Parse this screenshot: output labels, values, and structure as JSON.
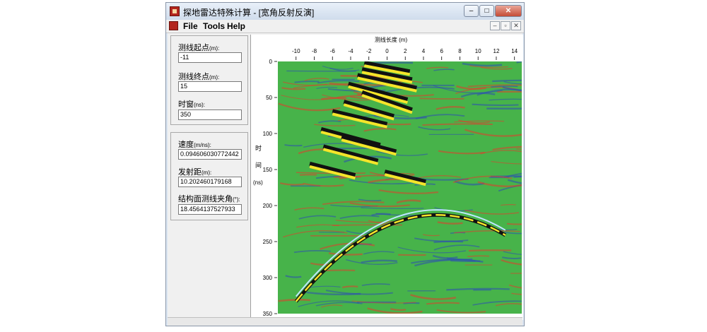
{
  "window": {
    "title": "探地雷达特殊计算 - [宽角反射反演]"
  },
  "menu": {
    "items": [
      "File",
      "Tools",
      "Help"
    ]
  },
  "input_panel": {
    "start_label": "测线起点",
    "start_unit": "(m):",
    "start_value": "-11",
    "end_label": "测线终点",
    "end_unit": "(m):",
    "end_value": "15",
    "window_label": "时窗",
    "window_unit": "(ns):",
    "window_value": "350"
  },
  "result_panel": {
    "velocity_label": "速度",
    "velocity_unit": "(m/ns):",
    "velocity_value": "0.094606030772442",
    "offset_label": "发射距",
    "offset_unit": "(m):",
    "offset_value": "10.202460179168",
    "angle_label": "结构面测线夹角",
    "angle_unit": "(°):",
    "angle_value": "18.4564137527933"
  },
  "plot": {
    "x_axis_title": "测线长度 (m)",
    "x_ticks": [
      "-10",
      "-8",
      "-6",
      "-4",
      "-2",
      "0",
      "2",
      "4",
      "6",
      "8",
      "10",
      "12",
      "14"
    ],
    "y_axis_title_chars": [
      "时",
      "间",
      "(ns)"
    ],
    "y_ticks": [
      "0",
      "50",
      "100",
      "150",
      "200",
      "250",
      "300",
      "350"
    ]
  },
  "colors": {
    "radar_bg": "#47b34a",
    "pos": "#f4e52a",
    "neg": "#2b4db5",
    "mid": "#e33b2c",
    "fit": "#bfe7ff"
  }
}
